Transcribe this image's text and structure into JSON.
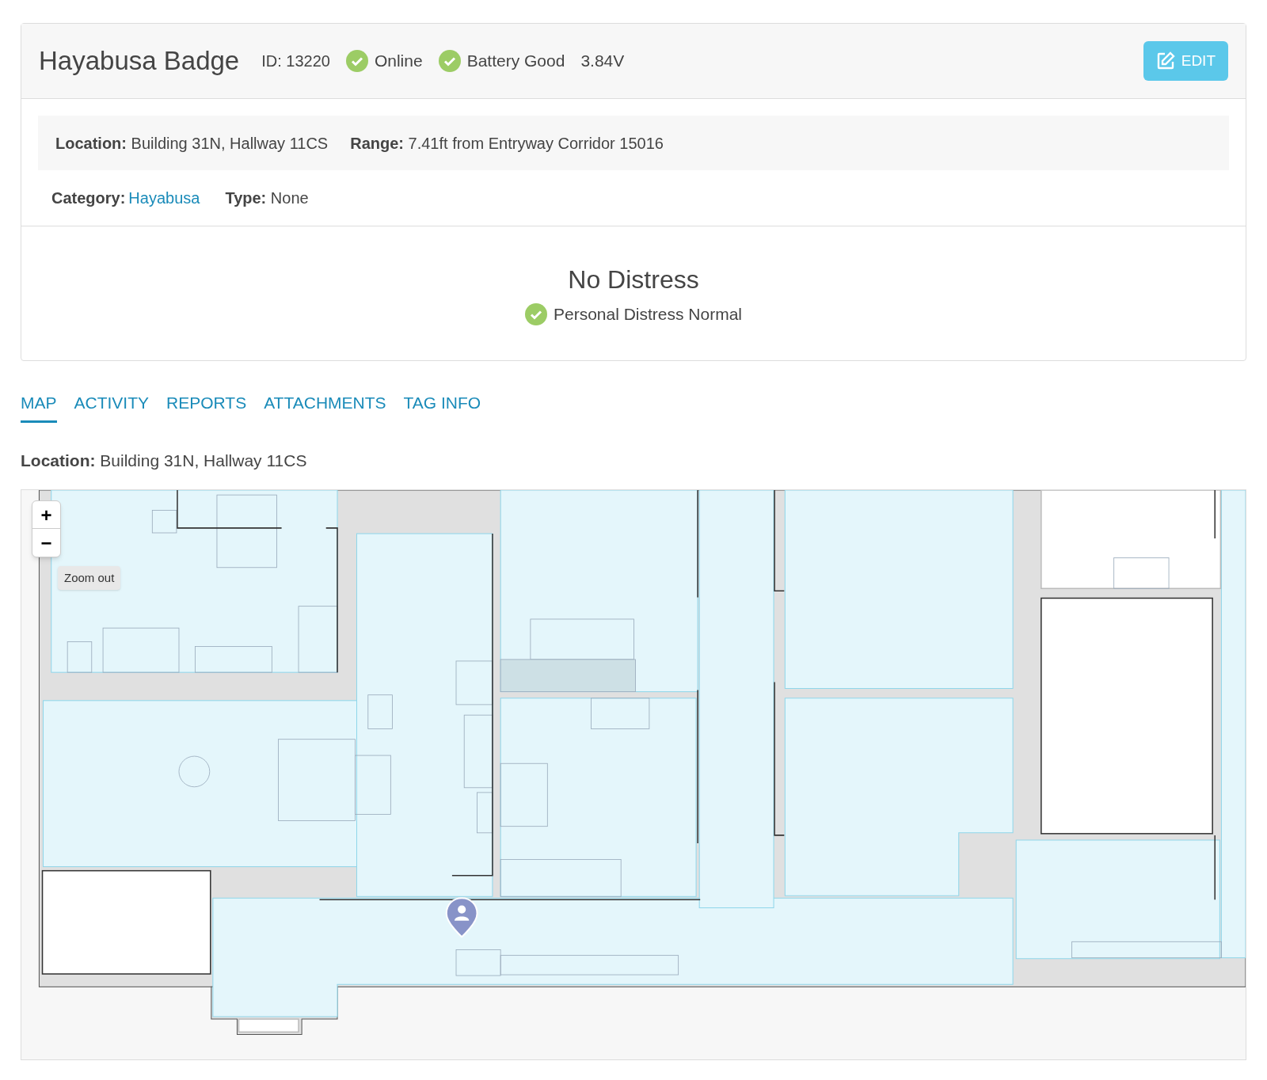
{
  "device": {
    "name": "Hayabusa Badge",
    "id": "ID: 13220",
    "statuses": [
      {
        "kind": "check",
        "label": "Online"
      },
      {
        "kind": "check",
        "label": "Battery Good"
      },
      {
        "kind": "text",
        "label": "3.84V"
      }
    ],
    "edit_button": "EDIT"
  },
  "details": {
    "location": {
      "label": "Location:",
      "value": "Building 31N, Hallway 11CS"
    },
    "range": {
      "label": "Range:",
      "value": "7.41ft from Entryway Corridor 15016"
    },
    "category": {
      "label": "Category:",
      "value": "Hayabusa"
    },
    "type": {
      "label": "Type:",
      "value": "None"
    }
  },
  "distress": {
    "title": "No Distress",
    "status": "Personal Distress Normal"
  },
  "tabs": [
    {
      "label": "MAP",
      "selected": true
    },
    {
      "label": "ACTIVITY",
      "selected": false
    },
    {
      "label": "REPORTS",
      "selected": false
    },
    {
      "label": "ATTACHMENTS",
      "selected": false
    },
    {
      "label": "TAG INFO",
      "selected": false
    }
  ],
  "map": {
    "location": {
      "label": "Location:",
      "value": "Building 31N, Hallway 11CS"
    },
    "zoom_in": "+",
    "zoom_out": "−",
    "tooltip": "Zoom out"
  }
}
